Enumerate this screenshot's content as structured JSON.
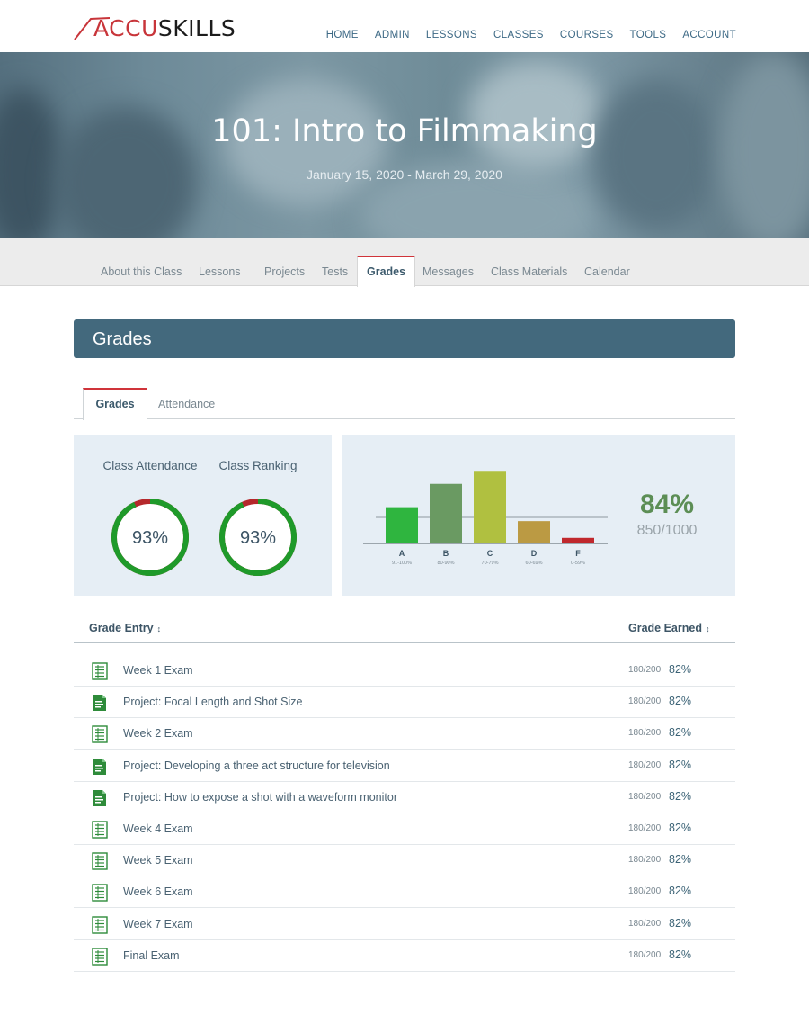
{
  "brand": {
    "logo_part1": "ACCU",
    "logo_part2": "SKILLS"
  },
  "nav": [
    "HOME",
    "ADMIN",
    "LESSONS",
    "CLASSES",
    "COURSES",
    "TOOLS",
    "ACCOUNT"
  ],
  "hero": {
    "title": "101: Intro to Filmmaking",
    "dates": "January 15, 2020 - March 29, 2020"
  },
  "class_tabs": [
    "About this Class",
    "Lessons",
    "Projects",
    "Tests",
    "Grades",
    "Messages",
    "Class Materials",
    "Calendar"
  ],
  "active_class_tab": "Grades",
  "section_title": "Grades",
  "sub_tabs": [
    "Grades",
    "Attendance"
  ],
  "stats": {
    "attendance_label": "Class Attendance",
    "attendance_value": "93%",
    "attendance_fraction": 0.93,
    "ranking_label": "Class Ranking",
    "ranking_value": "93%",
    "ranking_fraction": 0.93,
    "overall_pct": "84%",
    "overall_score": "850/1000"
  },
  "chart_data": {
    "type": "bar",
    "categories": [
      "A",
      "B",
      "C",
      "D",
      "F"
    ],
    "sublabels": [
      "91-100%",
      "80-90%",
      "70-79%",
      "60-69%",
      "0-59%"
    ],
    "values": [
      39,
      64,
      78,
      24,
      6
    ],
    "reference_line": 28,
    "ylim": [
      0,
      85
    ],
    "colors": [
      "#2fb53f",
      "#6a9a62",
      "#b0c040",
      "#bb9a43",
      "#c0282d"
    ],
    "title": "",
    "xlabel": "",
    "ylabel": ""
  },
  "table": {
    "col_entry": "Grade Entry",
    "col_earned": "Grade Earned",
    "rows": [
      {
        "title": "Week 1 Exam",
        "type": "exam",
        "score": "180/200",
        "pct": "82%"
      },
      {
        "title": "Project: Focal Length and Shot Size",
        "type": "project",
        "score": "180/200",
        "pct": "82%"
      },
      {
        "title": "Week 2 Exam",
        "type": "exam",
        "score": "180/200",
        "pct": "82%"
      },
      {
        "title": "Project: Developing a three act structure for television",
        "type": "project",
        "score": "180/200",
        "pct": "82%"
      },
      {
        "title": "Project: How to expose a shot with a waveform monitor",
        "type": "project",
        "score": "180/200",
        "pct": "82%"
      },
      {
        "title": "Week 4 Exam",
        "type": "exam",
        "score": "180/200",
        "pct": "82%"
      },
      {
        "title": "Week 5 Exam",
        "type": "exam",
        "score": "180/200",
        "pct": "82%"
      },
      {
        "title": "Week 6 Exam",
        "type": "exam",
        "score": "180/200",
        "pct": "82%"
      },
      {
        "title": "Week 7 Exam",
        "type": "exam",
        "score": "180/200",
        "pct": "82%"
      },
      {
        "title": "Final Exam",
        "type": "exam",
        "score": "180/200",
        "pct": "82%"
      }
    ]
  },
  "icons": {
    "exam": "exam-sheet-icon",
    "project": "project-doc-icon",
    "sort": "sort-arrow-icon"
  },
  "colors": {
    "accent_red": "#d0343a",
    "header_blue": "#43697d",
    "ring_green": "#1f9a2a",
    "ring_red": "#b5282c",
    "score_green": "#5c8e55"
  }
}
